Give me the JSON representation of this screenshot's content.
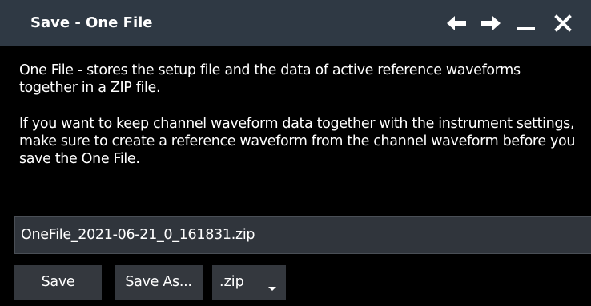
{
  "window": {
    "title": "Save - One File",
    "icons": {
      "back": "arrow-left-icon",
      "forward": "arrow-right-icon",
      "minimize": "minimize-icon",
      "close": "close-icon"
    }
  },
  "description": {
    "paragraph1": "One File - stores the setup file and the data of active reference waveforms together in a ZIP file.",
    "paragraph2": "If you want to keep channel waveform data together with the instrument settings, make sure to create a reference waveform from the channel waveform before you save the One File."
  },
  "file": {
    "name": "OneFile_2021-06-21_0_161831.zip"
  },
  "buttons": {
    "save": "Save",
    "save_as": "Save As..."
  },
  "extension_select": {
    "value": ".zip"
  },
  "colors": {
    "titlebar": "#2f3944",
    "background": "#000000",
    "field": "#30353c",
    "button": "#34383e",
    "text": "#ffffff"
  }
}
